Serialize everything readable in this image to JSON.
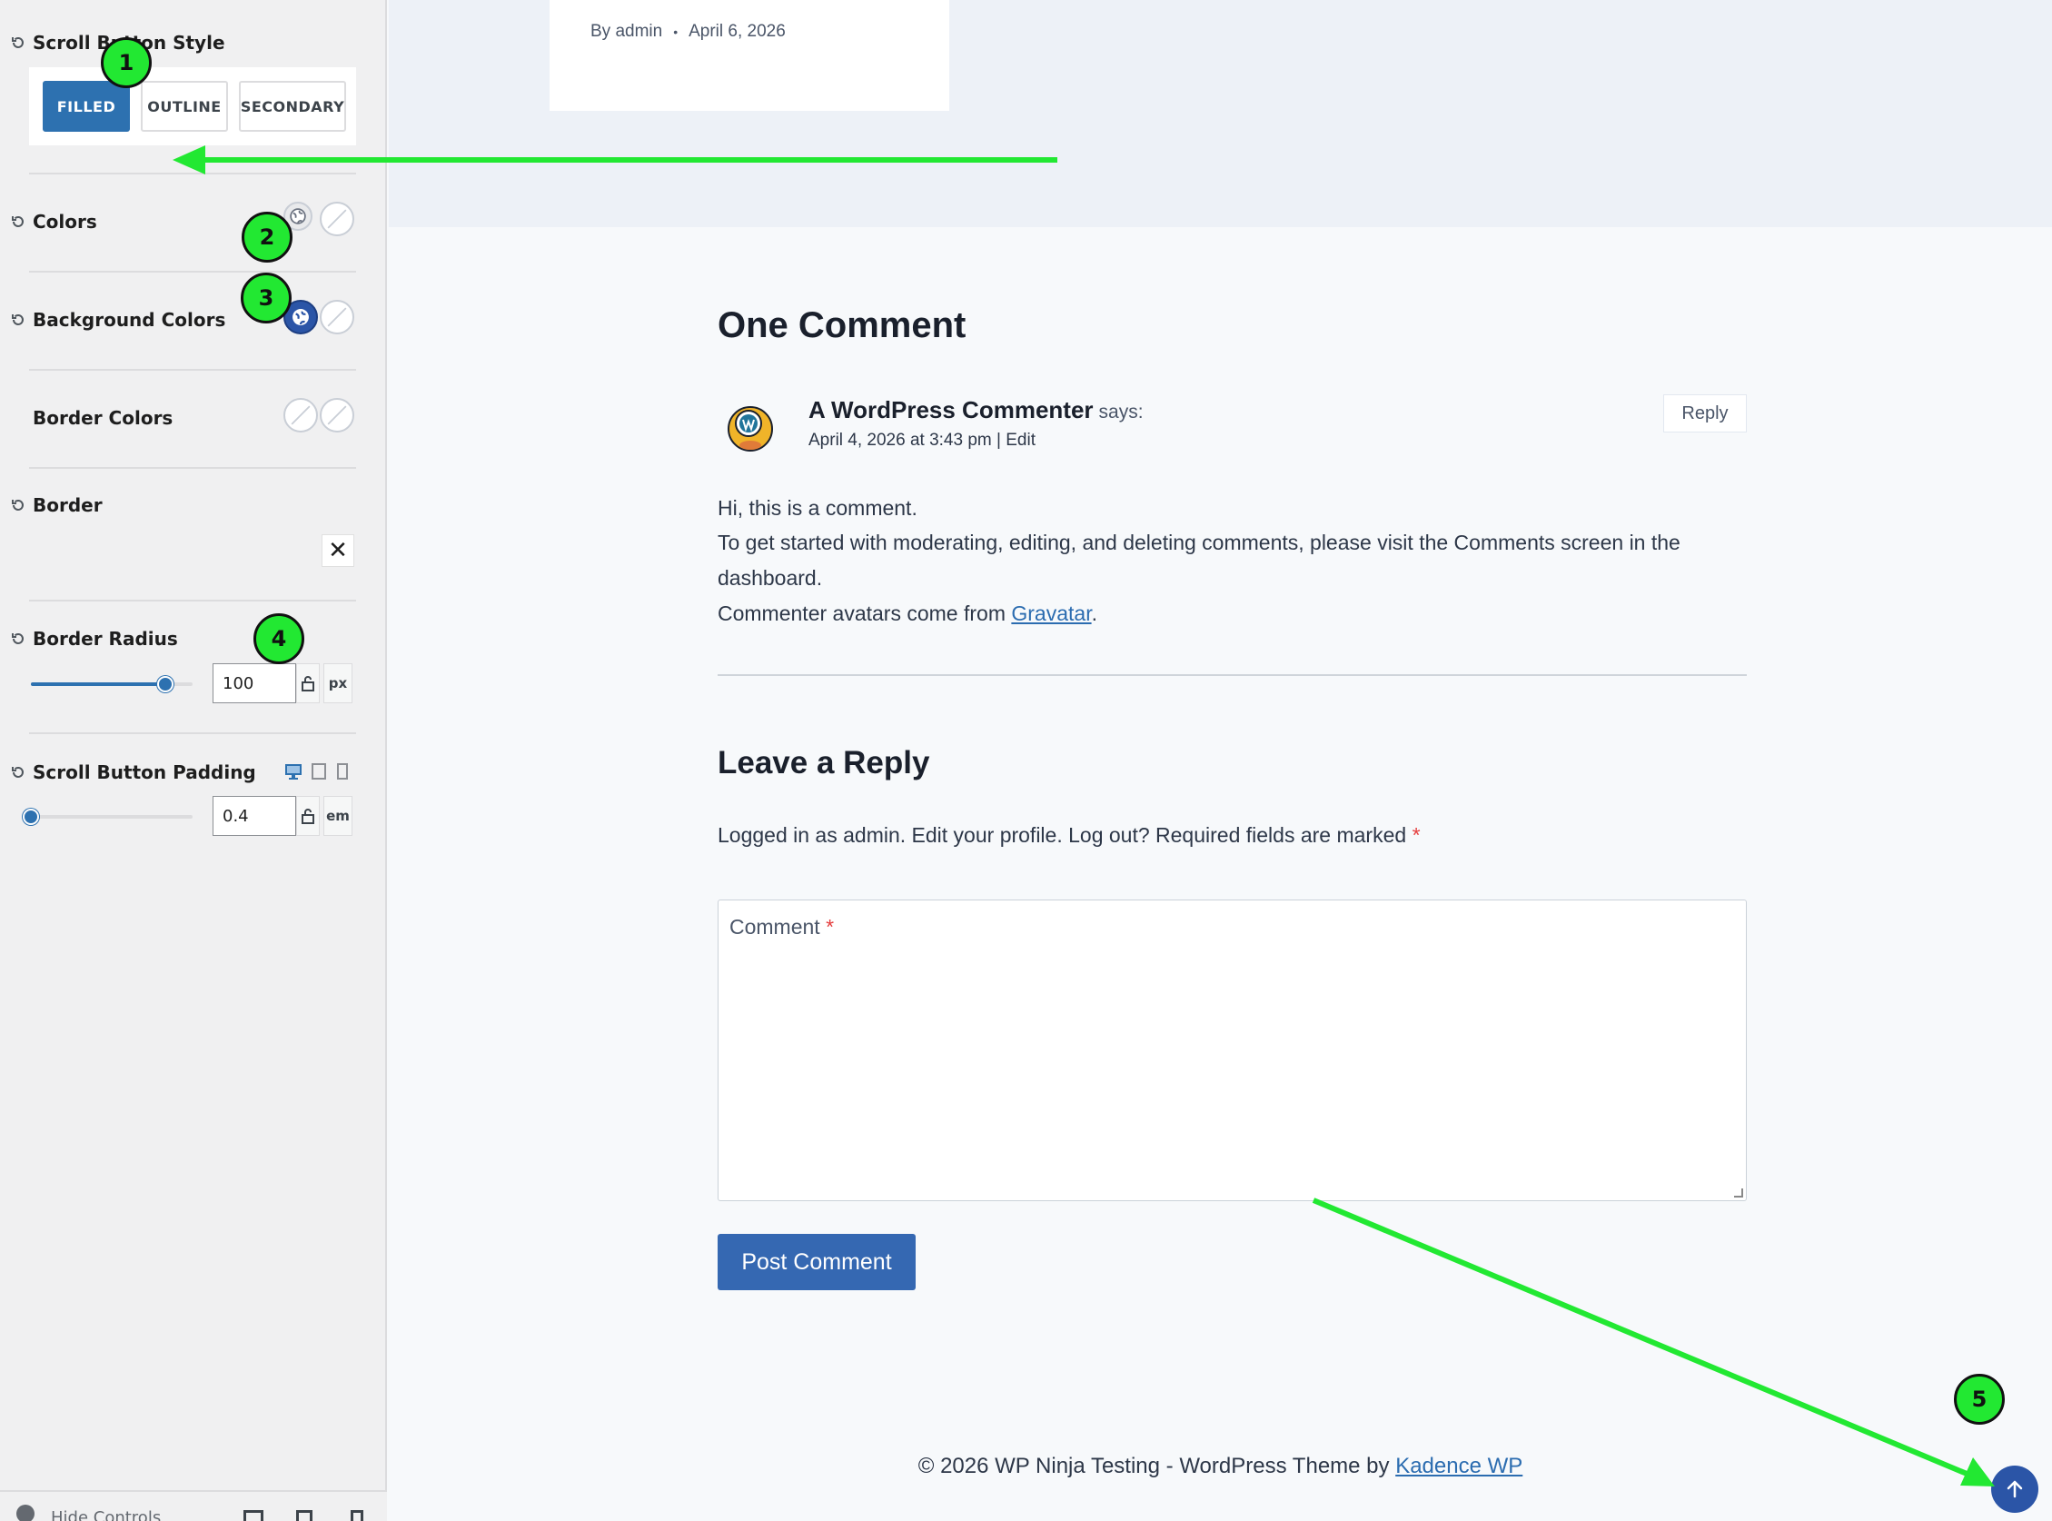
{
  "sidebar": {
    "scroll_button_style": {
      "label": "Scroll Button Style",
      "options": [
        "FILLED",
        "OUTLINE",
        "SECONDARY"
      ],
      "selected": "FILLED"
    },
    "colors": {
      "label": "Colors"
    },
    "background_colors": {
      "label": "Background Colors"
    },
    "border_colors": {
      "label": "Border Colors"
    },
    "border": {
      "label": "Border",
      "clear_glyph": "✕"
    },
    "border_radius": {
      "label": "Border Radius",
      "value": "100",
      "unit": "px",
      "slider_fraction": 0.83
    },
    "scroll_button_padding": {
      "label": "Scroll Button Padding",
      "value": "0.4",
      "unit": "em",
      "slider_fraction": 0.0
    },
    "hide_controls": {
      "label": "Hide Controls"
    }
  },
  "preview": {
    "post_meta": {
      "author": "By admin",
      "separator": "•",
      "date": "April 6, 2026"
    },
    "comments_title": "One Comment",
    "comment": {
      "author": "A WordPress Commenter",
      "says": "says:",
      "date_line": "April 4, 2026 at 3:43 pm | Edit",
      "reply_label": "Reply",
      "line1": "Hi, this is a comment.",
      "line2": "To get started with moderating, editing, and deleting comments, please visit the Comments screen in the",
      "line3": "dashboard.",
      "line4_prefix": "Commenter avatars come from ",
      "line4_link": "Gravatar",
      "line4_suffix": "."
    },
    "reply_title": "Leave a Reply",
    "logged_in_text": "Logged in as admin. Edit your profile. Log out? Required fields are marked",
    "required_mark": "*",
    "comment_placeholder": "Comment",
    "post_button": "Post Comment",
    "footer_text": "© 2026 WP Ninja Testing - WordPress Theme by ",
    "footer_link": "Kadence WP"
  },
  "annotations": {
    "markers": [
      "1",
      "2",
      "3",
      "4",
      "5"
    ]
  },
  "colors": {
    "accent": "#2d71b0",
    "scroll_button_bg": "#2b55a7",
    "annotation": "#22e832"
  },
  "icons": {
    "reset": "reset-icon",
    "globe": "globe-icon",
    "lock": "lock-icon",
    "desktop": "desktop-icon",
    "tablet": "tablet-icon",
    "mobile": "mobile-icon",
    "arrow_up": "arrow-up-icon"
  }
}
